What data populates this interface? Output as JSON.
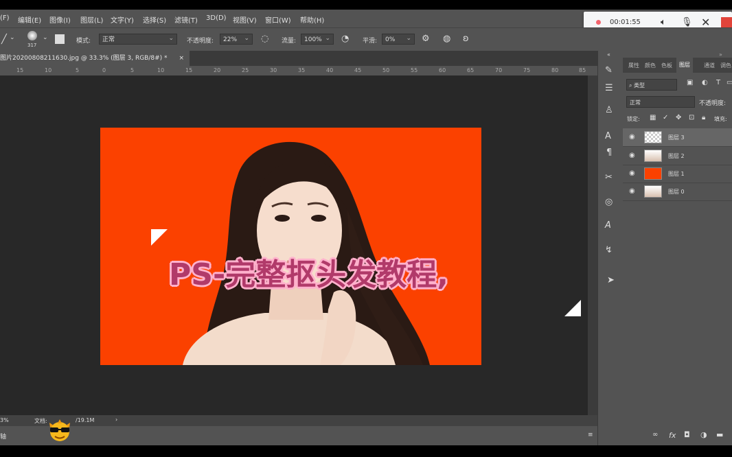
{
  "menu": {
    "items": [
      "(F)",
      "编辑(E)",
      "图像(I)",
      "图层(L)",
      "文字(Y)",
      "选择(S)",
      "滤镜(T)",
      "3D(D)",
      "视图(V)",
      "窗口(W)",
      "帮助(H)"
    ]
  },
  "options": {
    "brush_size": "317",
    "mode_label": "模式:",
    "mode_value": "正常",
    "opacity_label": "不透明度:",
    "opacity_value": "22%",
    "flow_label": "流量:",
    "flow_value": "100%",
    "smooth_label": "平滑:",
    "smooth_value": "0%"
  },
  "document": {
    "tab_title": "图片20200808211630.jpg @ 33.3% (图层 3, RGB/8#) *",
    "close": "×",
    "zoom": "3%",
    "doc_info_label": "文档:",
    "doc_info_value": "/19.1M"
  },
  "ruler": {
    "ticks": [
      "15",
      "10",
      "5",
      "0",
      "5",
      "10",
      "15",
      "20",
      "25",
      "30",
      "35",
      "40",
      "45",
      "50",
      "55",
      "60",
      "65",
      "70",
      "75",
      "80",
      "85"
    ]
  },
  "bottom": {
    "label": "轴"
  },
  "recorder": {
    "time": "00:01:55"
  },
  "panel": {
    "tabs": [
      "属性",
      "颜色",
      "色板",
      "图层",
      "通道",
      "调色"
    ],
    "active_tab": "图层",
    "filter_value": "类型",
    "blend_mode": "正常",
    "opacity_label": "不透明度:",
    "lock_label": "锁定:",
    "fill_label": "填充:",
    "fx_label": "fx"
  },
  "layers": [
    {
      "name": "图层 3",
      "thumb": "#ffffff"
    },
    {
      "name": "图层 2",
      "thumb": "#d8c0b0"
    },
    {
      "name": "图层 1",
      "thumb": "#fb4100"
    },
    {
      "name": "图层 0",
      "thumb": "#d8c0b0"
    }
  ],
  "caption": {
    "text": "PS-完整抠头发教程,"
  },
  "colors": {
    "canvas_bg": "#fb4100",
    "ui_panel": "#535353",
    "workspace": "#282828"
  }
}
